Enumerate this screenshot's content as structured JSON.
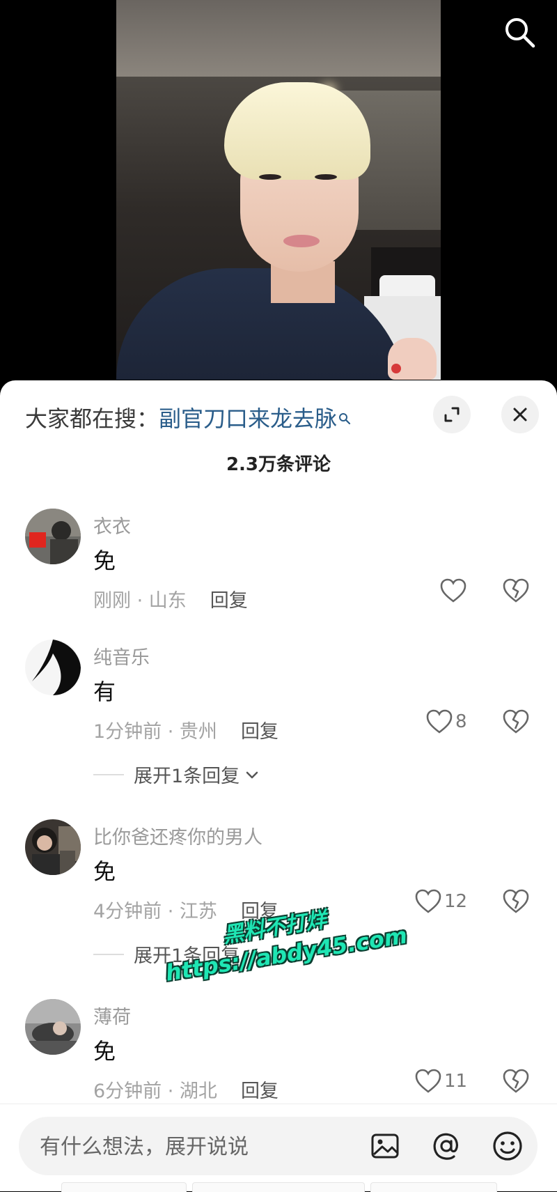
{
  "video": {
    "search_icon": "search-icon"
  },
  "sheet": {
    "trending_prefix": "大家都在搜：",
    "trending_query": "副官刀口来龙去脉",
    "comment_count": "2.3万条评论",
    "expand_icon": "expand-icon",
    "close_icon": "close-icon"
  },
  "comments": [
    {
      "username": "衣衣",
      "text": "免",
      "meta": "刚刚 · 山东",
      "reply_label": "回复",
      "likes": ""
    },
    {
      "username": "纯音乐",
      "text": "有",
      "meta": "1分钟前 · 贵州",
      "reply_label": "回复",
      "likes": "8",
      "expand_replies": "展开1条回复"
    },
    {
      "username": "比你爸还疼你的男人",
      "text": "免",
      "meta": "4分钟前 · 江苏",
      "reply_label": "回复",
      "likes": "12",
      "expand_replies": "展开1条回复"
    },
    {
      "username": "薄荷",
      "text": "免",
      "meta": "6分钟前 · 湖北",
      "reply_label": "回复",
      "likes": "11"
    }
  ],
  "watermark": {
    "line1": "黑料不打烊",
    "line2": "https://abdy45.com"
  },
  "input": {
    "placeholder": "有什么想法，展开说说",
    "image_icon": "image-icon",
    "mention_icon": "at-mention-icon",
    "emoji_icon": "emoji-icon"
  },
  "colors": {
    "link": "#2a5d8a",
    "meta": "#a3a3a3",
    "watermark": "#1fe6b4"
  }
}
